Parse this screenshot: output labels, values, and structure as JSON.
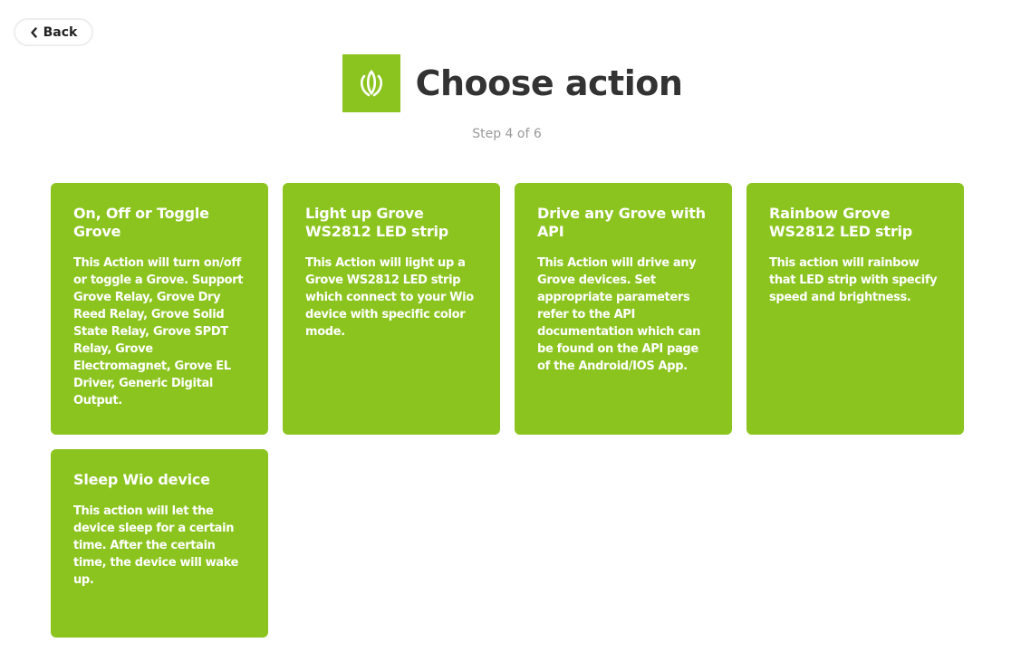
{
  "colors": {
    "accent": "#8cc41f",
    "title": "#333333",
    "muted": "#999999"
  },
  "nav": {
    "back_icon": "chevron-left-icon",
    "back_label": "Back"
  },
  "header": {
    "logo_icon": "wio-grove-logo-icon",
    "title": "Choose action",
    "step": "Step 4 of 6"
  },
  "actions": [
    {
      "title": "On, Off or Toggle Grove",
      "description": "This Action will turn on/off or toggle a Grove. Support Grove Relay, Grove Dry Reed Relay, Grove Solid State Relay, Grove SPDT Relay, Grove Electromagnet, Grove EL Driver, Generic Digital Output."
    },
    {
      "title": "Light up Grove WS2812 LED strip",
      "description": "This Action will light up a Grove WS2812 LED strip which connect to your Wio device with specific color mode."
    },
    {
      "title": "Drive any Grove with API",
      "description": "This Action will drive any Grove devices. Set appropriate parameters refer to the API documentation which can be found on the API page of the Android/IOS App."
    },
    {
      "title": "Rainbow Grove WS2812 LED strip",
      "description": "This action will rainbow that LED strip with specify speed and brightness."
    },
    {
      "title": "Sleep Wio device",
      "description": "This action will let the device sleep for a certain time. After the certain time, the device will wake up."
    }
  ]
}
